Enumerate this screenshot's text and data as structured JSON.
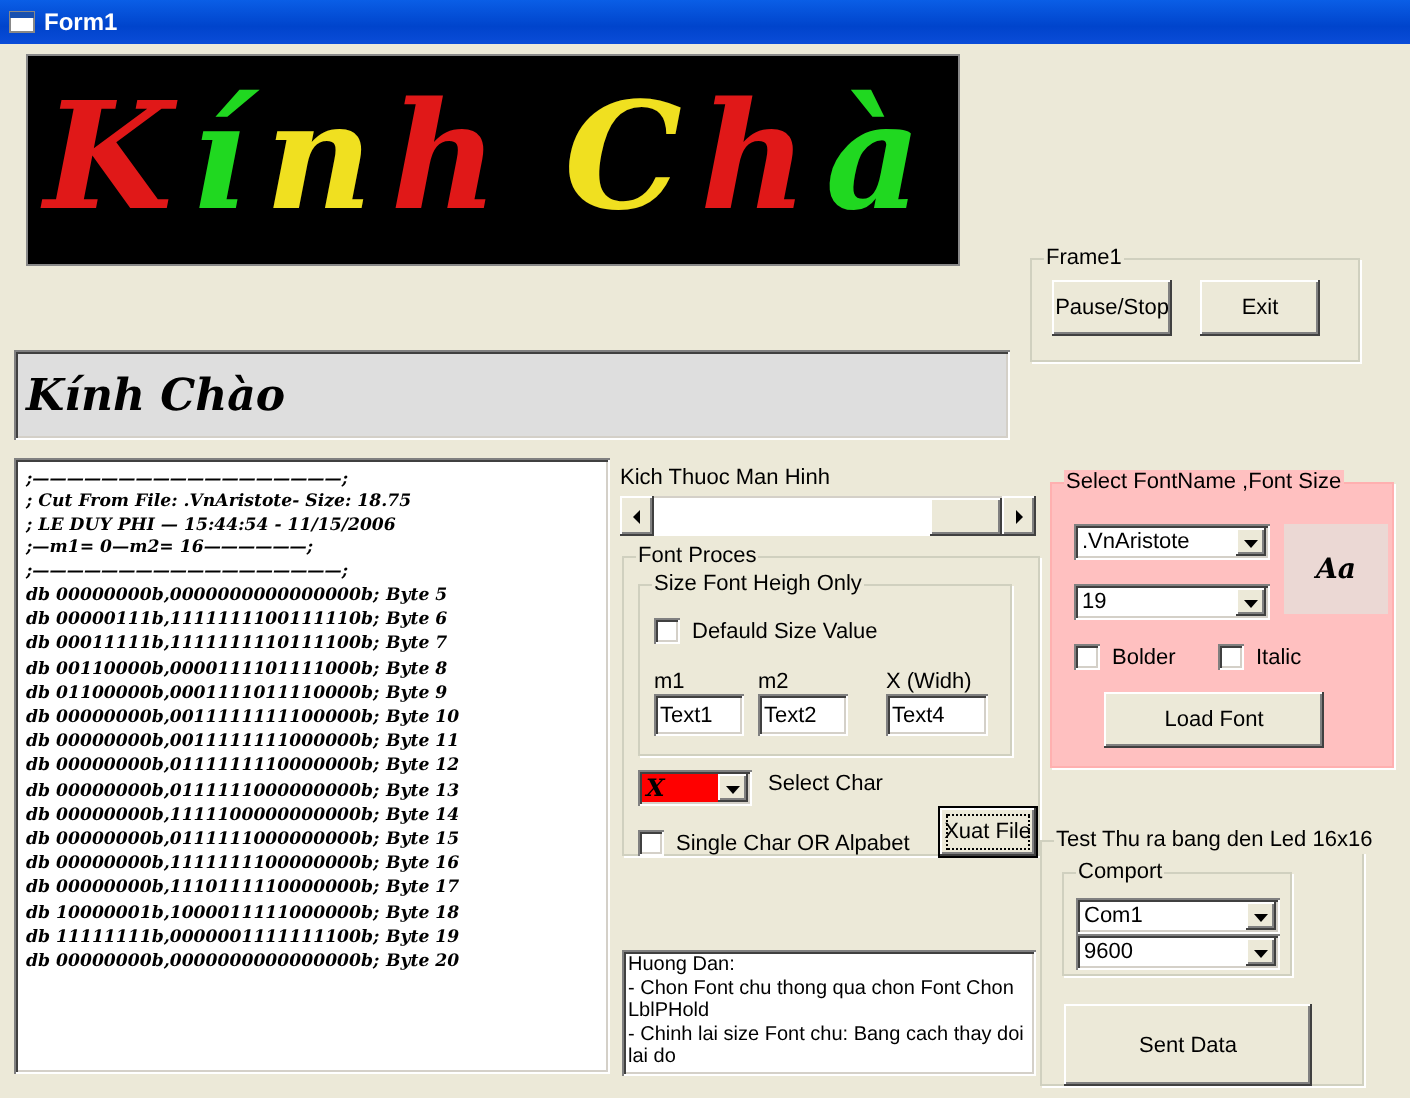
{
  "window": {
    "title": "Form1"
  },
  "led_display": {
    "words": [
      {
        "letters": [
          {
            "char": "K",
            "color": "#e01818"
          },
          {
            "char": "í",
            "color": "#20d820"
          },
          {
            "char": "n",
            "color": "#f0e020"
          },
          {
            "char": "h",
            "color": "#e01818"
          }
        ]
      },
      {
        "letters": [
          {
            "char": "C",
            "color": "#f0e020"
          },
          {
            "char": "h",
            "color": "#e01818"
          },
          {
            "char": "à",
            "color": "#20d820"
          }
        ]
      }
    ]
  },
  "banner": {
    "text": "Kính Chào"
  },
  "frame1": {
    "title": "Frame1",
    "buttons": [
      "Pause/Stop",
      "Exit"
    ]
  },
  "output_text": {
    "header_lines": [
      ";——————————————————;",
      "; Cut From File:  .VnAristote- Size: 18.75",
      ";  LE DUY PHI —  15:44:54  -  11/15/2006",
      ";—m1= 0—m2= 16——————;",
      ";——————————————————;"
    ],
    "rows": [
      {
        "code": "db 00000000b,0000000000000000b;",
        "label": "Byte 5"
      },
      {
        "code": "db 00000111b,1111111100111110b;",
        "label": "Byte 6"
      },
      {
        "code": "db 00011111b,1111111110111100b;",
        "label": "Byte 7"
      },
      {
        "code": "db 00110000b,0000111101111000b;",
        "label": "Byte 8"
      },
      {
        "code": "db 01100000b,0001111011110000b;",
        "label": "Byte 9"
      },
      {
        "code": "db 00000000b,0011111111100000b;",
        "label": "Byte 10"
      },
      {
        "code": "db 00000000b,0011111111000000b;",
        "label": "Byte 11"
      },
      {
        "code": "db 00000000b,0111111110000000b;",
        "label": "Byte 12"
      },
      {
        "code": "db 00000000b,0111111000000000b;",
        "label": "Byte 13"
      },
      {
        "code": "db 00000000b,1111100000000000b;",
        "label": "Byte 14"
      },
      {
        "code": "db 00000000b,0111111000000000b;",
        "label": "Byte 15"
      },
      {
        "code": "db 00000000b,1111111100000000b;",
        "label": "Byte 16"
      },
      {
        "code": "db 00000000b,1110111110000000b;",
        "label": "Byte 17"
      },
      {
        "code": "db 10000001b,1000011111000000b;",
        "label": "Byte 18"
      },
      {
        "code": "db 11111111b,0000001111111100b;",
        "label": "Byte 19"
      },
      {
        "code": "db 00000000b,0000000000000000b;",
        "label": "Byte 20"
      }
    ]
  },
  "screen_size": {
    "label": "Kich Thuoc Man Hinh"
  },
  "font_process": {
    "title": "Font Proces",
    "size_group": {
      "title": "Size Font Heigh Only",
      "default_checkbox": {
        "label": "Defauld Size Value",
        "checked": false
      },
      "fields": [
        {
          "label": "m1",
          "value": "Text1"
        },
        {
          "label": "m2",
          "value": "Text2"
        },
        {
          "label": "X (Widh)",
          "value": "Text4"
        }
      ]
    },
    "char_select": {
      "value": "X",
      "label": "Select Char"
    },
    "single_char": {
      "label": "Single Char OR Alpabet",
      "checked": false
    },
    "export_button": "Xuat File"
  },
  "instructions": {
    "lines": [
      "Huong Dan:",
      "- Chon Font chu thong qua chon Font Chon LblPHold",
      "- Chinh lai size Font chu: Bang cach thay doi lai do"
    ]
  },
  "font_select": {
    "title": "Select FontName ,Font Size",
    "font_name": ".VnAristote",
    "font_size": "19",
    "preview": "Aa",
    "bold": {
      "label": "Bolder",
      "checked": false
    },
    "italic": {
      "label": "Italic",
      "checked": false
    },
    "load_button": "Load Font"
  },
  "led_test": {
    "title": "Test Thu ra bang den Led 16x16",
    "comport": {
      "title": "Comport",
      "port": "Com1",
      "baud": "9600"
    },
    "send_button": "Sent Data"
  }
}
